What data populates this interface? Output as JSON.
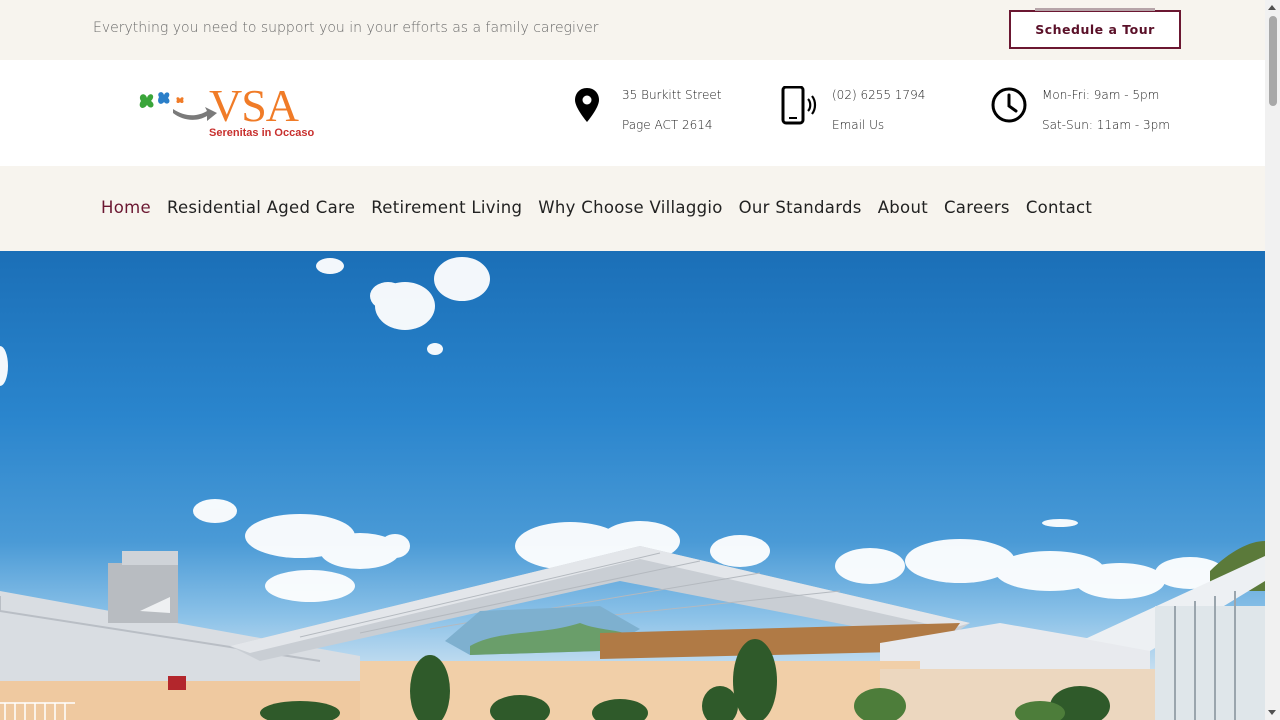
{
  "topbar": {
    "tagline": "Everything you need to support you in your efforts as a family caregiver",
    "tour_button": "Schedule a Tour"
  },
  "logo": {
    "name": "VSA",
    "subtitle": "Serenitas in Occaso"
  },
  "contact": {
    "address_line1": "35 Burkitt Street",
    "address_line2": "Page ACT 2614",
    "phone": "(02) 6255 1794",
    "email_link": "Email Us",
    "hours_weekday": "Mon-Fri: 9am - 5pm",
    "hours_weekend": "Sat-Sun: 11am - 3pm"
  },
  "nav": {
    "items": [
      {
        "label": "Home",
        "active": true
      },
      {
        "label": "Residential Aged Care"
      },
      {
        "label": "Retirement Living"
      },
      {
        "label": "Why Choose Villaggio"
      },
      {
        "label": "Our Standards"
      },
      {
        "label": "About"
      },
      {
        "label": "Careers"
      },
      {
        "label": "Contact"
      }
    ]
  },
  "icons": {
    "address": "map-pin-icon",
    "phone": "mobile-phone-icon",
    "hours": "clock-icon"
  },
  "colors": {
    "brand": "#6b1731",
    "accent_orange": "#f07b27",
    "topbar_bg": "#f7f4ee"
  }
}
